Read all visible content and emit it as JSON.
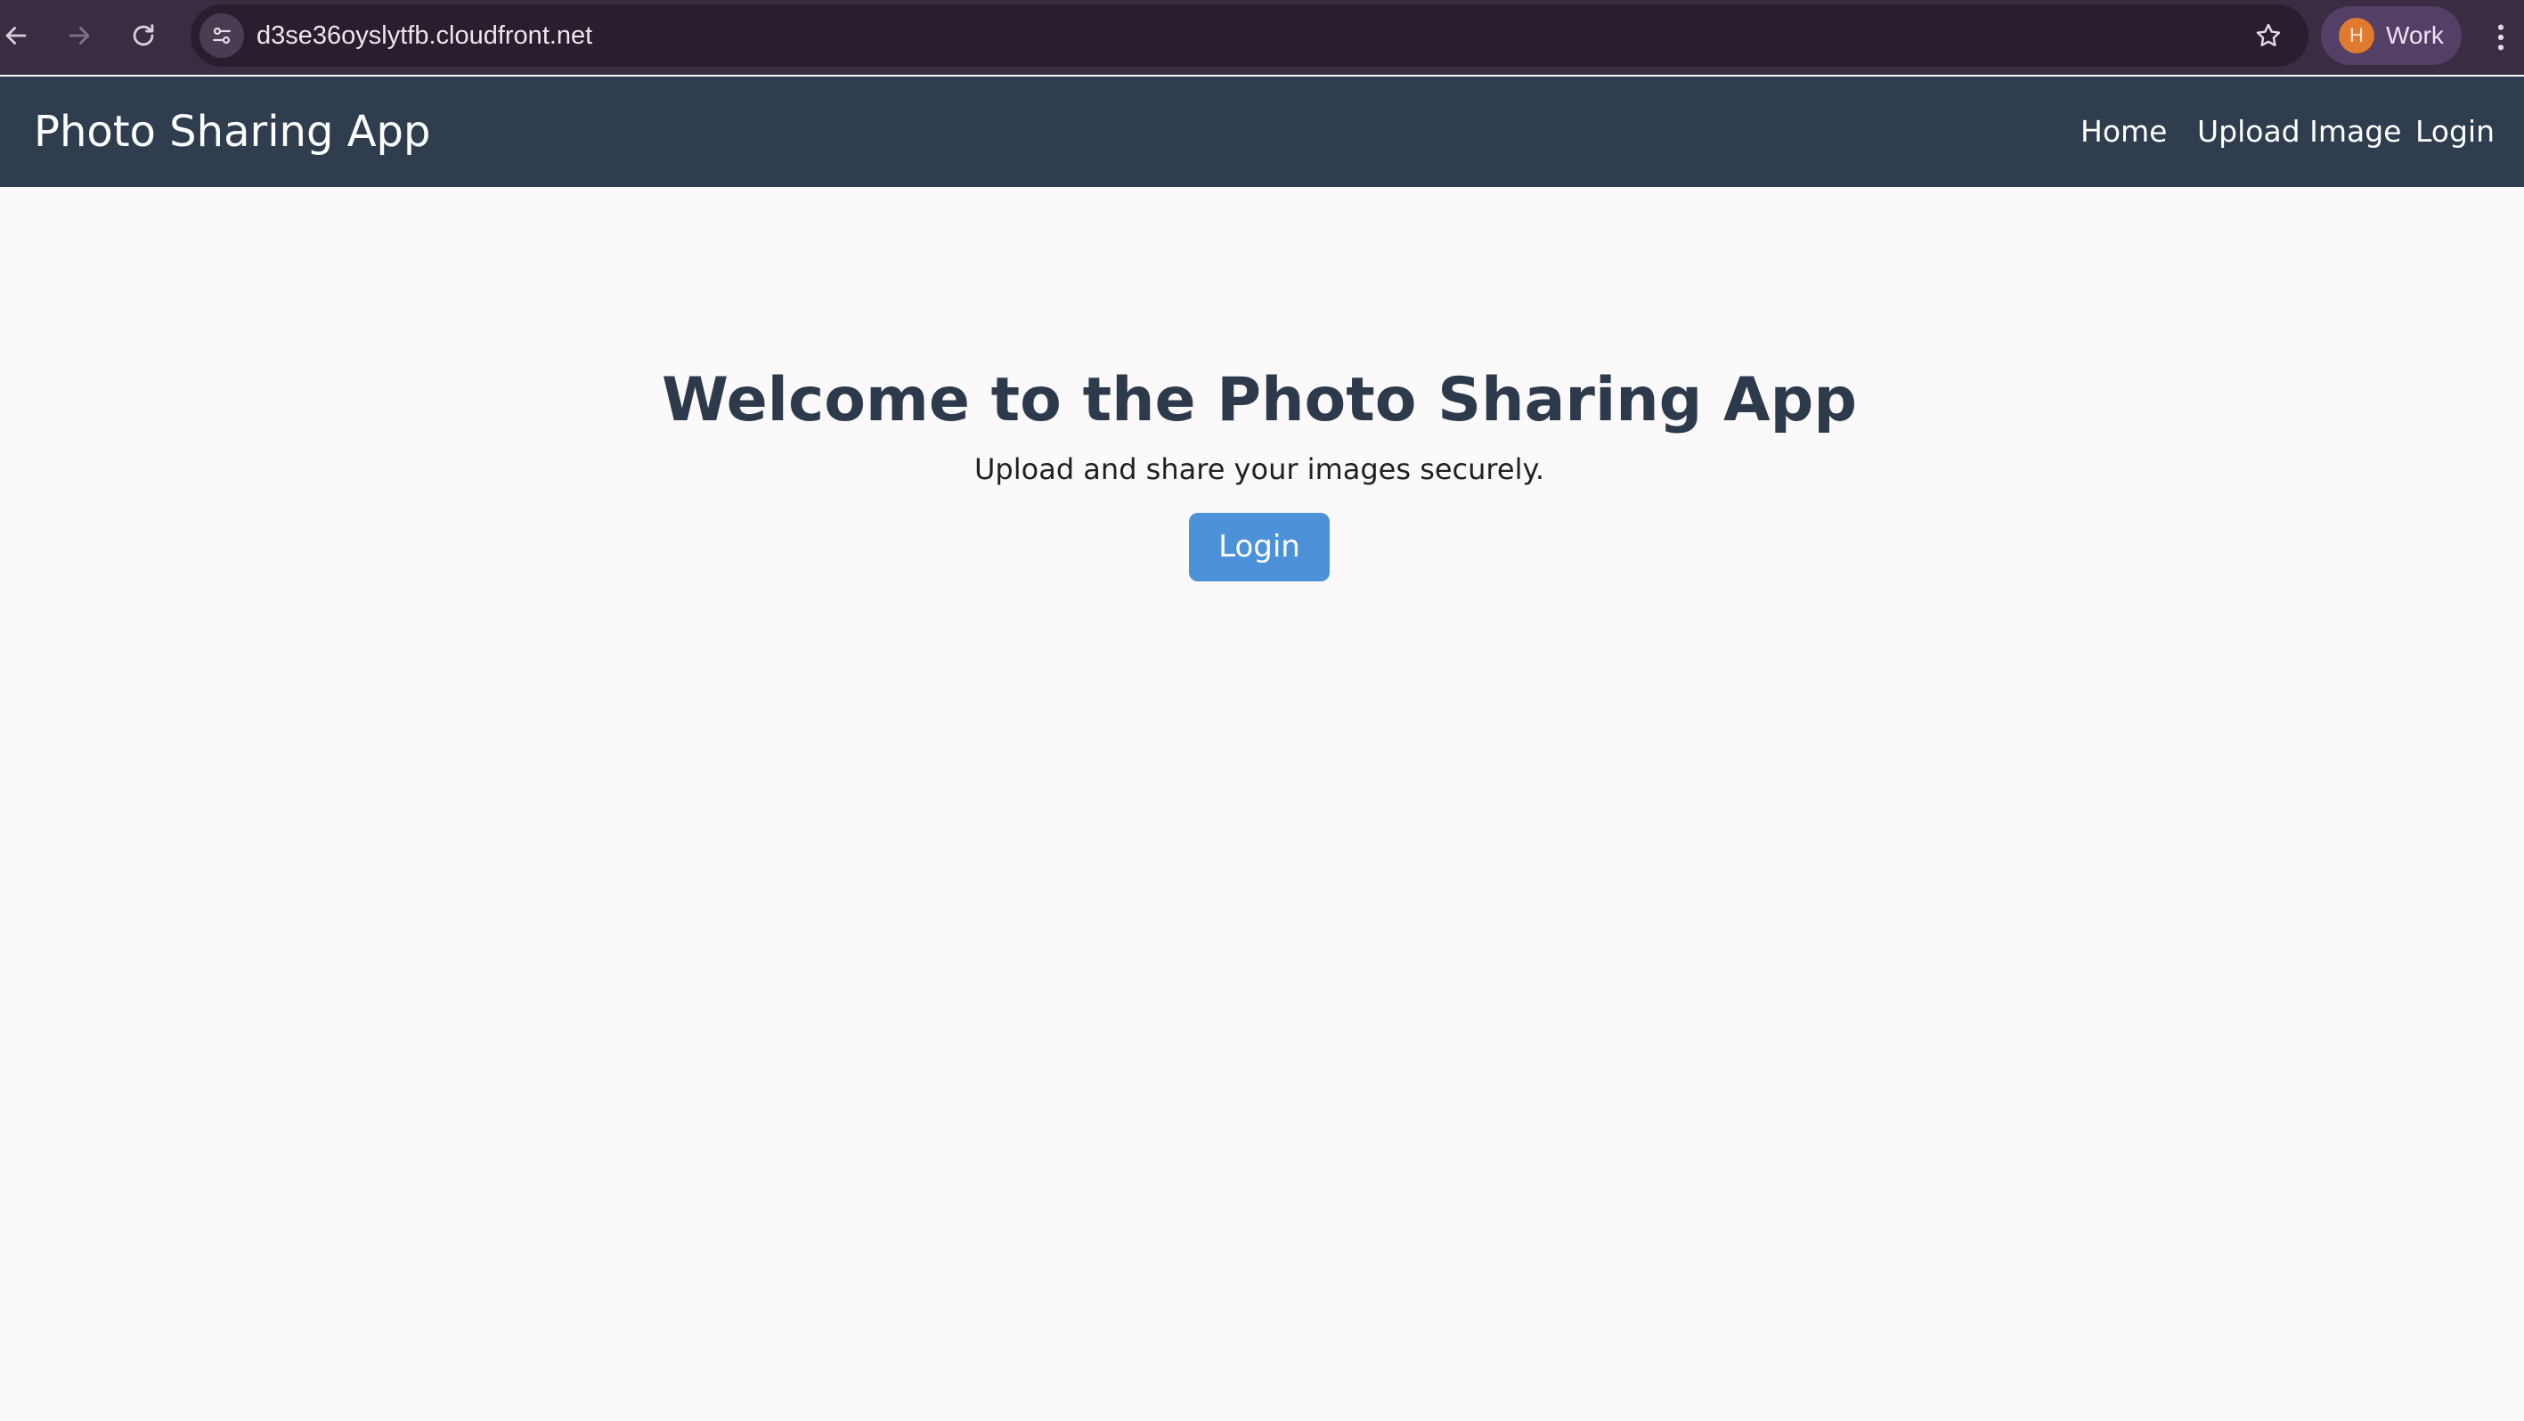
{
  "browser": {
    "url": "d3se36oyslytfb.cloudfront.net",
    "profile_initial": "H",
    "profile_name": "Work",
    "icons": [
      "back-arrow-icon",
      "forward-arrow-icon",
      "reload-icon",
      "site-settings-icon",
      "bookmark-star-icon",
      "kebab-menu-icon"
    ]
  },
  "nav": {
    "brand": "Photo Sharing App",
    "links": [
      {
        "label": "Home"
      },
      {
        "label": "Upload Image"
      },
      {
        "label": "Login"
      }
    ]
  },
  "hero": {
    "title": "Welcome to the Photo Sharing App",
    "subtitle": "Upload and share your images securely.",
    "button_label": "Login"
  },
  "colors": {
    "chrome_bg": "#3a2d41",
    "omnibox_bg": "#291d2e",
    "navbar_bg": "#2f3d4f",
    "page_bg": "#fcf9fa",
    "heading_text": "#2d3a4c",
    "button_bg": "#4d92d8",
    "profile_chip_bg": "#543f67",
    "avatar_bg": "#e07a2e"
  }
}
